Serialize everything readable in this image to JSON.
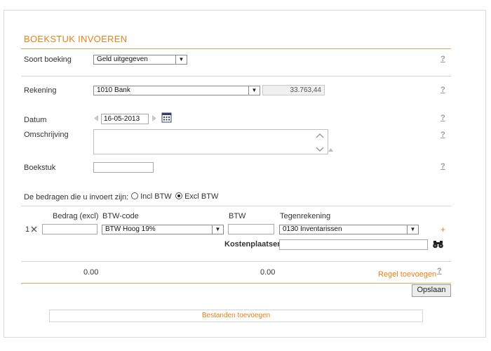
{
  "form": {
    "title": "BOEKSTUK INVOEREN",
    "help": "?",
    "soort_boeking": {
      "label": "Soort boeking",
      "value": "Geld uitgegeven"
    },
    "rekening": {
      "label": "Rekening",
      "value": "1010 Bank",
      "balance": "33.763,44"
    },
    "datum": {
      "label": "Datum",
      "value": "16-05-2013"
    },
    "omschrijving": {
      "label": "Omschrijving",
      "value": ""
    },
    "boekstuk": {
      "label": "Boekstuk",
      "value": ""
    },
    "amounts_mode": {
      "label": "De bedragen die u invoert zijn:",
      "options": [
        "Incl BTW",
        "Excl BTW"
      ],
      "selected": "Excl BTW"
    }
  },
  "lines": {
    "headers": {
      "bedrag": "Bedrag (excl)",
      "btw_code": "BTW-code",
      "btw": "BTW",
      "tegenrekening": "Tegenrekening"
    },
    "rows": [
      {
        "number": "1",
        "bedrag": "",
        "btw_code": "BTW Hoog 19%",
        "btw": "",
        "tegenrekening": "0130 Inventarissen",
        "kostenplaats_label": "Kostenplaatsen",
        "kostenplaats": ""
      }
    ],
    "totals": {
      "bedrag": "0.00",
      "btw": "0.00"
    },
    "add_line": "Regel toevoegen",
    "add_symbol": "+"
  },
  "actions": {
    "save": "Opslaan",
    "add_files": "Bestanden toevoegen"
  }
}
